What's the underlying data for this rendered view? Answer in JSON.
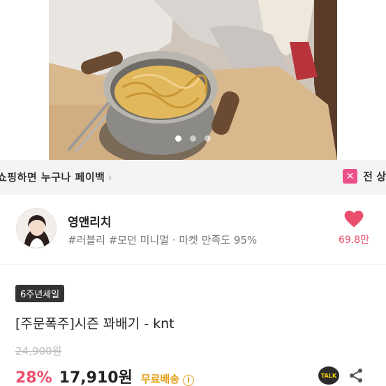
{
  "carousel": {
    "dots": [
      {
        "active": true
      },
      {
        "active": false
      },
      {
        "active": false
      }
    ]
  },
  "promo": {
    "left_text": "쇼핑하면 누구나 페이백",
    "chevron": "›",
    "badge_icon": "✕",
    "right_text": "전 상"
  },
  "shop": {
    "name": "영앤리치",
    "tags": "#러블리 #모던 미니멀 · 마켓 만족도 95%",
    "favorite_count": "69.8만",
    "heart_color": "#ec4f6e"
  },
  "product": {
    "sale_badge": "6주년세일",
    "title": "[주문폭주]시즌 꽈배기 - knt",
    "original_price": "24,900원",
    "discount": "28%",
    "price": "17,910원",
    "shipping": "무료배송",
    "info_icon": "i",
    "talk_label": "TALK"
  },
  "colors": {
    "accent_pink": "#ec4f6e",
    "shipping_gold": "#e2a01b"
  }
}
